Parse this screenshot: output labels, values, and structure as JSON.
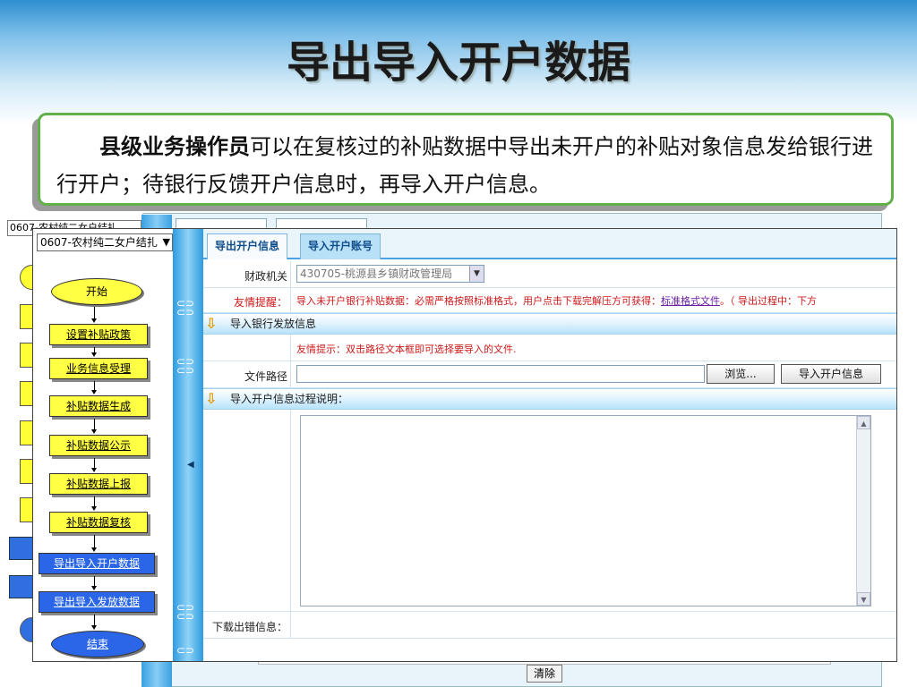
{
  "slide": {
    "title": "导出导入开户数据",
    "callout_role": "县级业务操作员",
    "callout_text": "可以在复核过的补贴数据中导出未开户的补贴对象信息发给银行进行开户；待银行反馈开户信息时，再导入开户信息。"
  },
  "background_window": {
    "clear_button": "清除"
  },
  "sidebar": {
    "project_select": "0607-农村纯二女户结扎",
    "flow": [
      {
        "label": "开始",
        "style": "ellipse-yellow"
      },
      {
        "label": "设置补贴政策",
        "style": "box-yellow"
      },
      {
        "label": "业务信息受理",
        "style": "box-yellow"
      },
      {
        "label": "补贴数据生成",
        "style": "box-yellow"
      },
      {
        "label": "补贴数据公示",
        "style": "box-yellow"
      },
      {
        "label": "补贴数据上报",
        "style": "box-yellow"
      },
      {
        "label": "补贴数据复核",
        "style": "box-yellow"
      },
      {
        "label": "导出导入开户数据",
        "style": "box-blue"
      },
      {
        "label": "导出导入发放数据",
        "style": "box-blue"
      },
      {
        "label": "结束",
        "style": "ellipse-blue"
      }
    ]
  },
  "tabs": [
    {
      "label": "导出开户信息",
      "active": false
    },
    {
      "label": "导入开户账号",
      "active": true
    }
  ],
  "form": {
    "finance_label": "财政机关",
    "finance_value": "430705-桃源县乡镇财政管理局",
    "reminder_label": "友情提醒：",
    "reminder_text": "导入未开户银行补贴数据：必需严格按照标准格式，用户点击下载完解压方可获得：",
    "reminder_link": "标准格式文件",
    "reminder_tail": "。（ 导出过程中：下方",
    "section_import": "导入银行发放信息",
    "tip_text": "友情提示：双击路径文本框即可选择要导入的文件.",
    "path_label": "文件路径",
    "browse_button": "浏览...",
    "import_button": "导入开户信息",
    "section_process": "导入开户信息过程说明：",
    "download_error_label": "下载出错信息："
  },
  "colors": {
    "callout_border": "#62b04a",
    "flow_yellow": "#ffff44",
    "flow_blue": "#2c66e8",
    "reminder_red": "#cc1a1a",
    "link_purple": "#6b1fa5"
  }
}
